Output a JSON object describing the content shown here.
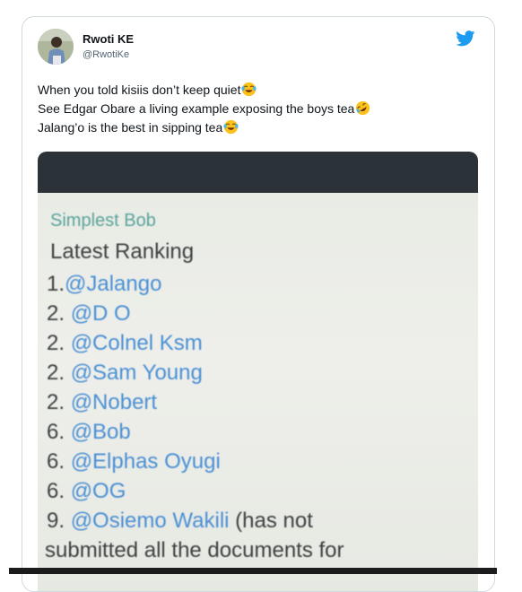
{
  "tweet": {
    "author_name": "Rwoti KE",
    "author_handle": "@RwotiKe",
    "lines": [
      "When you told kisiis don’t keep quiet",
      "See Edgar Obare a living example exposing the boys tea",
      "Jalang’o  is the best in sipping tea"
    ],
    "line_emojis": [
      "tears-of-joy-emoji",
      "rolling-laughing-emoji",
      "tears-of-joy-emoji"
    ],
    "brand_color": "#1d9bf0"
  },
  "screenshot": {
    "sender": "Simplest Bob",
    "heading": "Latest Ranking",
    "rankings": [
      {
        "rank": "1.",
        "handle": "@Jalango",
        "note": ""
      },
      {
        "rank": "2. ",
        "handle": "@D O",
        "note": ""
      },
      {
        "rank": "2. ",
        "handle": "@Colnel Ksm",
        "note": ""
      },
      {
        "rank": "2. ",
        "handle": "@Sam Young",
        "note": ""
      },
      {
        "rank": "2. ",
        "handle": "@Nobert",
        "note": ""
      },
      {
        "rank": "6. ",
        "handle": "@Bob",
        "note": ""
      },
      {
        "rank": "6. ",
        "handle": "@Elphas Oyugi",
        "note": ""
      },
      {
        "rank": "6. ",
        "handle": "@OG",
        "note": ""
      },
      {
        "rank": "9. ",
        "handle": "@Osiemo Wakili",
        "note": " (has not"
      }
    ],
    "continuation": "submitted all the documents for",
    "handle_color": "#4a8fd4",
    "sender_color": "#5aa49c"
  }
}
